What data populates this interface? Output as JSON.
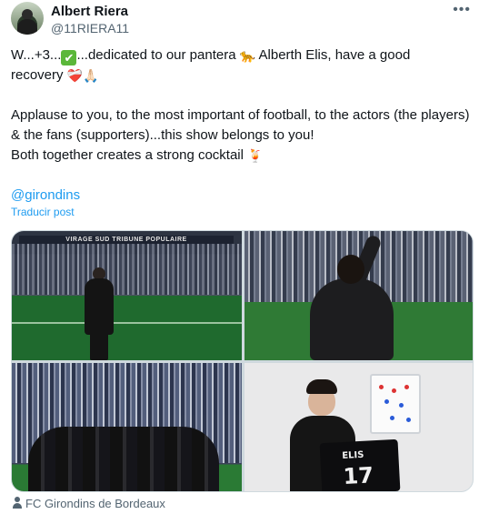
{
  "author": {
    "display_name": "Albert Riera",
    "handle": "@11RIERA11",
    "more_icon": "more-horizontal-icon"
  },
  "tweet": {
    "line1_a": "W...+3...",
    "line1_check": "✔",
    "line1_b": "...dedicated to our pantera ",
    "line1_leopard": "🐆",
    "line1_c": " Alberth Elis, have a good",
    "line2_a": "recovery ",
    "line2_emoji": "❤️‍🩹🙏🏻",
    "para2": "Applause to you, to the most important of football, to the actors (the players) & the fans (supporters)...this show belongs to you!",
    "para3_a": "Both together creates a strong cocktail ",
    "para3_emoji": "🍹",
    "mention": "@girondins"
  },
  "translate_label": "Traducir post",
  "media": {
    "banner_text": "VIRAGE SUD TRIBUNE POPULAIRE",
    "shirt_name": "ELIS",
    "shirt_number": "17"
  },
  "location": {
    "label": "FC Girondins de Bordeaux",
    "icon": "person-tag-icon"
  },
  "colors": {
    "link": "#1d9bf0",
    "text": "#0f1419",
    "secondary": "#536471"
  }
}
